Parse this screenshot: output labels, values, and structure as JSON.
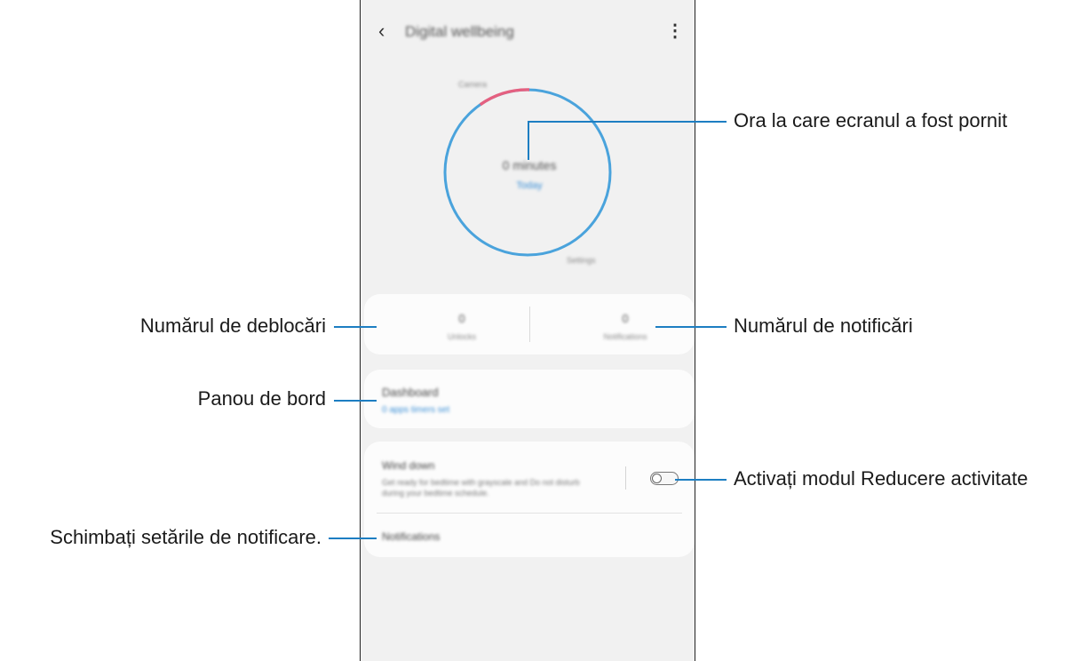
{
  "screen": {
    "appbar": {
      "back_icon": "‹",
      "title": "Digital wellbeing",
      "more_icon": "⋮"
    },
    "gauge": {
      "value": "0 minutes",
      "link": "Today",
      "label_top": "Camera",
      "label_bottom": "Settings",
      "colors": {
        "ring": "#4aa3dc",
        "highlight": "#e46080"
      }
    },
    "stats": {
      "unlocks": {
        "value": "0",
        "label": "Unlocks"
      },
      "notifications": {
        "value": "0",
        "label": "Notifications"
      }
    },
    "dashboard": {
      "title": "Dashboard",
      "subtitle": "0 apps timers set"
    },
    "wind_down": {
      "title": "Wind down",
      "description": "Get ready for bedtime with grayscale and Do not disturb during your bedtime schedule.",
      "toggle_on": false
    },
    "notifications_row": {
      "label": "Notifications"
    }
  },
  "callouts": {
    "screen_time": "Ora la care ecranul a fost pornit",
    "unlocks": "Numărul de deblocări",
    "notifications": "Numărul de notificări",
    "dashboard": "Panou de bord",
    "wind_down": "Activați modul Reducere activitate",
    "notification_settings": "Schimbați setările de notificare."
  },
  "colors": {
    "leader": "#1d7ec2",
    "panel_bg": "#f1f1f1",
    "card_bg": "#fcfcfc",
    "link": "#3a8fd6"
  }
}
